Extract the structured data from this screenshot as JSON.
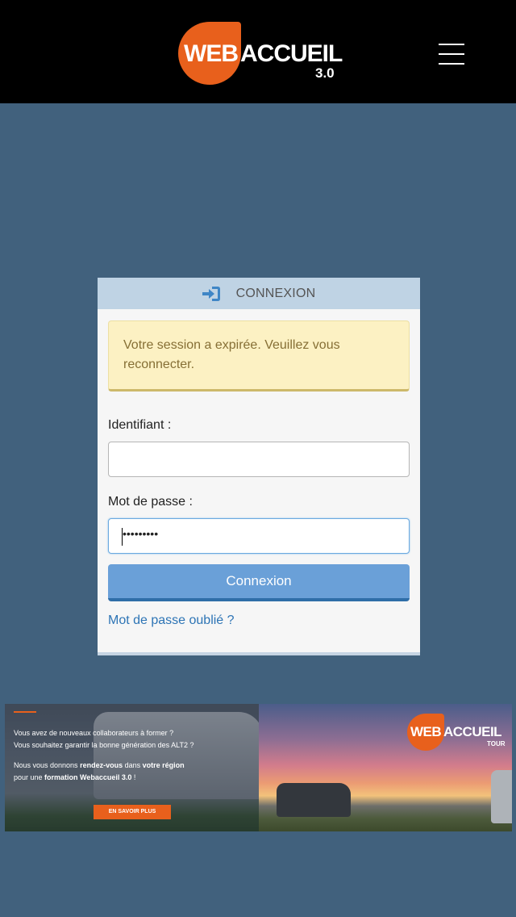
{
  "header": {
    "logo": {
      "web": "WEB",
      "accueil": "ACCUEIL",
      "version": "3.0"
    },
    "menu_icon": "hamburger-menu-icon"
  },
  "login": {
    "title": "CONNEXION",
    "title_icon": "sign-in-icon",
    "alert": "Votre session a expirée. Veuillez vous reconnecter.",
    "username_label": "Identifiant :",
    "username_value": "",
    "password_label": "Mot de passe :",
    "password_masked": "•••••••••",
    "submit_label": "Connexion",
    "forgot_label": "Mot de passe oublié ?"
  },
  "banner": {
    "line1": "Vous avez de nouveaux collaborateurs à former ?",
    "line2": "Vous souhaitez garantir la bonne génération des ALT2 ?",
    "line3_a": "Nous vous donnons ",
    "line3_b": "rendez-vous",
    "line3_c": " dans ",
    "line3_d": "votre région",
    "line4_a": "pour une ",
    "line4_b": "formation Webaccueil 3.0",
    "line4_c": " !",
    "cta": "EN SAVOIR PLUS",
    "logo_web": "WEB",
    "logo_accueil": "ACCUEIL",
    "logo_tour": "TOUR"
  },
  "colors": {
    "background": "#41617d",
    "header": "#000000",
    "brand_orange": "#e8601c",
    "panel_header": "#bfd3e4",
    "alert_bg": "#fcf1c3",
    "alert_text": "#866f35",
    "button": "#6aa0d8",
    "link": "#2d74b5"
  }
}
